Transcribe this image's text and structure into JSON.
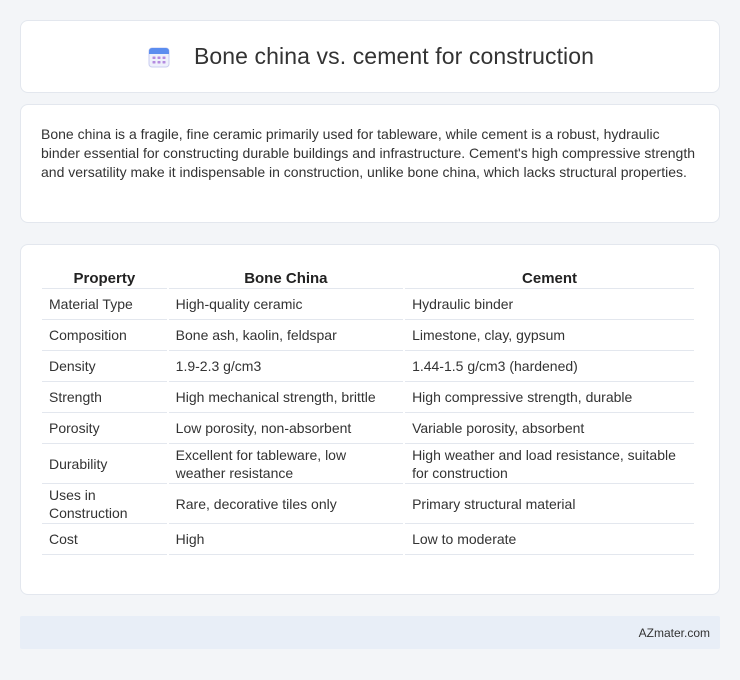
{
  "header": {
    "title": "Bone china vs. cement for construction",
    "icon": "calendar-icon"
  },
  "intro": {
    "text": "Bone china is a fragile, fine ceramic primarily used for tableware, while cement is a robust, hydraulic binder essential for constructing durable buildings and infrastructure. Cement's high compressive strength and versatility make it indispensable in construction, unlike bone china, which lacks structural properties."
  },
  "table": {
    "headers": [
      "Property",
      "Bone China",
      "Cement"
    ],
    "rows": [
      [
        "Material Type",
        "High-quality ceramic",
        "Hydraulic binder"
      ],
      [
        "Composition",
        "Bone ash, kaolin, feldspar",
        "Limestone, clay, gypsum"
      ],
      [
        "Density",
        "1.9-2.3 g/cm3",
        "1.44-1.5 g/cm3 (hardened)"
      ],
      [
        "Strength",
        "High mechanical strength, brittle",
        "High compressive strength, durable"
      ],
      [
        "Porosity",
        "Low porosity, non-absorbent",
        "Variable porosity, absorbent"
      ],
      [
        "Durability",
        "Excellent for tableware, low weather resistance",
        "High weather and load resistance, suitable for construction"
      ],
      [
        "Uses in Construction",
        "Rare, decorative tiles only",
        "Primary structural material"
      ],
      [
        "Cost",
        "High",
        "Low to moderate"
      ]
    ]
  },
  "footer": {
    "text": "AZmater.com"
  }
}
